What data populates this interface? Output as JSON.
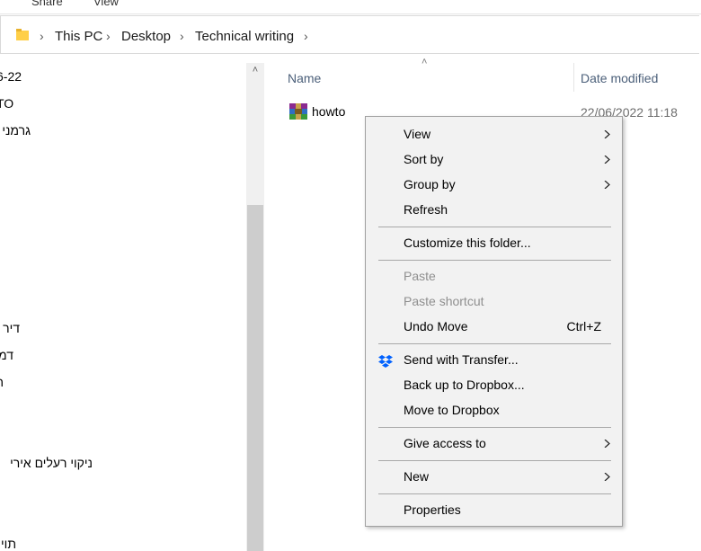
{
  "ribbon": {
    "tabs": [
      "Share",
      "View"
    ]
  },
  "address_bar": {
    "breadcrumbs": [
      "This PC",
      "Desktop",
      "Technical writing"
    ]
  },
  "nav_pane": {
    "items": [
      {
        "text": "6-22",
        "rtl": false
      },
      {
        "text": "TO",
        "rtl": false
      },
      {
        "text": "גרמני",
        "rtl": true
      },
      {
        "text": "דיר",
        "rtl": true
      },
      {
        "text": "דמ",
        "rtl": true
      },
      {
        "text": "ה",
        "rtl": true
      },
      {
        "text": "ניקוי רעלים אירי",
        "rtl": true
      },
      {
        "text": "תוי",
        "rtl": true
      }
    ]
  },
  "columns": {
    "name": "Name",
    "date_modified": "Date modified"
  },
  "file": {
    "name": "howto",
    "date": "22/06/2022 11:18",
    "icon": "winrar-archive-icon"
  },
  "context_menu": {
    "items": {
      "view": "View",
      "sort_by": "Sort by",
      "group_by": "Group by",
      "refresh": "Refresh",
      "customize": "Customize this folder...",
      "paste": "Paste",
      "paste_shortcut": "Paste shortcut",
      "undo_move": "Undo Move",
      "undo_shortcut": "Ctrl+Z",
      "send_transfer": "Send with Transfer...",
      "backup_dropbox": "Back up to Dropbox...",
      "move_dropbox": "Move to Dropbox",
      "give_access": "Give access to",
      "new": "New",
      "properties": "Properties"
    }
  },
  "colors": {
    "menu_bg": "#f2f2f2",
    "header_text": "#4c607a",
    "disabled_text": "#8f8f8f",
    "dropbox_blue": "#0061fe",
    "folder_yellow": "#ffcf48"
  }
}
